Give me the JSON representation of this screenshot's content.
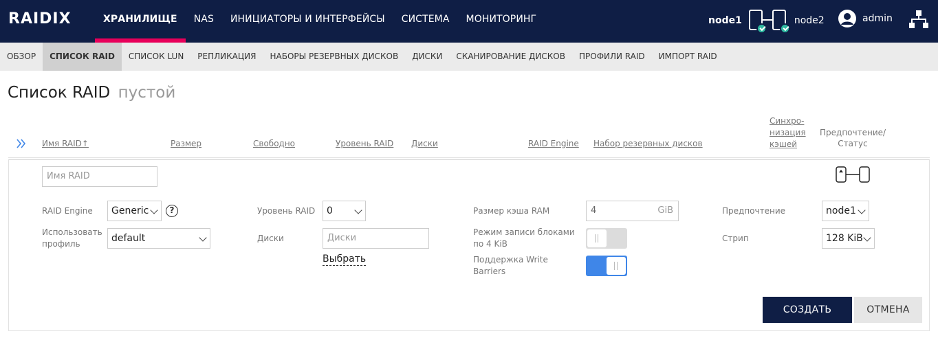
{
  "brand": {
    "logo_text": "RAIDIX"
  },
  "topnav": {
    "items": [
      {
        "label": "ХРАНИЛИЩЕ",
        "active": true
      },
      {
        "label": "NAS"
      },
      {
        "label": "ИНИЦИАТОРЫ И ИНТЕРФЕЙСЫ"
      },
      {
        "label": "СИСТЕМА"
      },
      {
        "label": "МОНИТОРИНГ"
      }
    ],
    "accent_color": "#e8005a",
    "bg_color": "#0f1e45"
  },
  "nodes": {
    "node1": "node1",
    "node2": "node2",
    "status_color": "#2eb8a0"
  },
  "user": {
    "name": "admin"
  },
  "subnav": {
    "items": [
      {
        "label": "ОБЗОР"
      },
      {
        "label": "СПИСОК RAID",
        "active": true
      },
      {
        "label": "СПИСОК LUN"
      },
      {
        "label": "РЕПЛИКАЦИЯ"
      },
      {
        "label": "НАБОРЫ РЕЗЕРВНЫХ ДИСКОВ"
      },
      {
        "label": "ДИСКИ"
      },
      {
        "label": "СКАНИРОВАНИЕ ДИСКОВ"
      },
      {
        "label": "ПРОФИЛИ RAID"
      },
      {
        "label": "ИМПОРТ RAID"
      }
    ]
  },
  "page": {
    "title": "Список RAID",
    "subtitle": "пустой"
  },
  "table": {
    "headers": {
      "name": "Имя RAID↑",
      "size": "Размер",
      "free": "Свободно",
      "level": "Уровень RAID",
      "disks": "Диски",
      "engine": "RAID Engine",
      "spare": "Набор резервных дисков",
      "sync_1": "Синхро-",
      "sync_2": "низация",
      "sync_3": "кэшей",
      "pref_1": "Предпочтение/",
      "pref_2": "Статус"
    }
  },
  "form": {
    "name_placeholder": "Имя RAID",
    "engine_label": "RAID Engine",
    "engine_value": "Generic",
    "help": "?",
    "profile_label_1": "Использовать",
    "profile_label_2": "профиль",
    "profile_value": "default",
    "level_label": "Уровень RAID",
    "level_value": "0",
    "disks_label": "Диски",
    "disks_placeholder": "Диски",
    "select_link": "Выбрать",
    "cache_label": "Размер кэша RAM",
    "cache_value": "4",
    "cache_unit": "GiB",
    "block4k_label_1": "Режим записи блоками",
    "block4k_label_2": "по 4 KiB",
    "block4k_on": false,
    "wb_label_1": "Поддержка Write",
    "wb_label_2": "Barriers",
    "wb_on": true,
    "pref_label": "Предпочтение",
    "pref_value": "node1",
    "strip_label": "Стрип",
    "strip_value": "128 KiB",
    "toggle_on_color": "#3f86e8"
  },
  "actions": {
    "create": "СОЗДАТЬ",
    "cancel": "ОТМЕНА"
  }
}
